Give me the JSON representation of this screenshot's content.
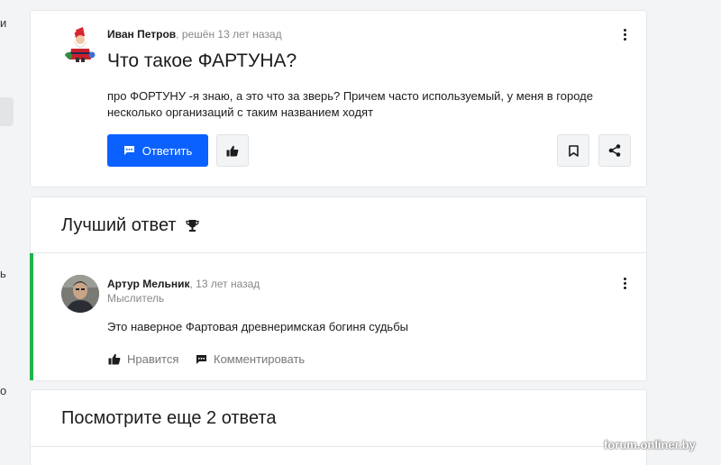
{
  "sidebar": {
    "frag_1": "и",
    "frag_2": "ь",
    "frag_3": "о"
  },
  "question": {
    "author": "Иван Петров",
    "meta": ", решён 13 лет назад",
    "title": "Что такое ФАРТУНА?",
    "text": "про ФОРТУНУ -я знаю, а это что за зверь? Причем часто используемый, у меня в городе несколько организаций с таким названием ходят",
    "reply_label": "Ответить"
  },
  "best_answer": {
    "section_title": "Лучший ответ",
    "author": "Артур Мельник",
    "meta": ", 13 лет назад",
    "role": "Мыслитель",
    "text": "Это наверное Фартовая древнеримская богиня судьбы",
    "like_label": "Нравится",
    "comment_label": "Комментировать"
  },
  "more_answers": {
    "section_title": "Посмотрите еще 2 ответа"
  },
  "watermark": "forum.onliner.by",
  "colors": {
    "primary": "#0b61ff",
    "best_answer_accent": "#1fb64a",
    "background": "#f3f4f5"
  }
}
